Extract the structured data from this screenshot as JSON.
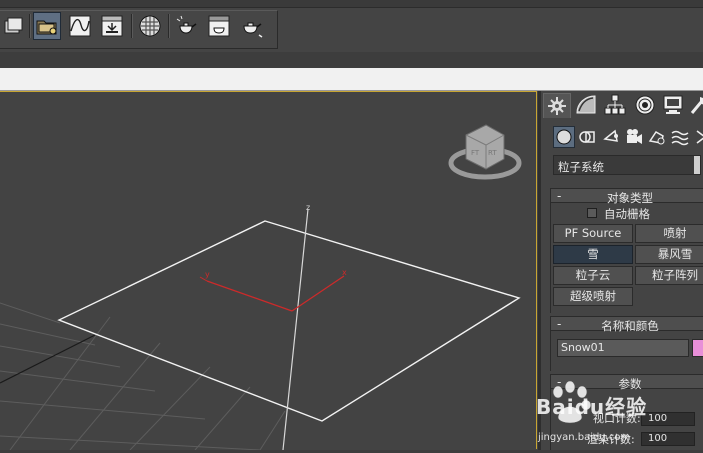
{
  "panel": {
    "category_dropdown": "粒子系统",
    "object_type": {
      "title": "对象类型",
      "autogrid_label": "自动栅格",
      "buttons": [
        "PF Source",
        "喷射",
        "雪",
        "暴风雪",
        "粒子云",
        "粒子阵列",
        "超级喷射"
      ],
      "active": "雪"
    },
    "name_color": {
      "title": "名称和颜色",
      "name": "Snow01",
      "color": "#e88fd8"
    },
    "parameters": {
      "title": "参数",
      "viewport_count_label": "视口计数:",
      "viewport_count": "100",
      "render_count_label": "渲染计数:",
      "render_count": "100"
    },
    "collapse_symbol": "-"
  },
  "viewport": {
    "axis_x": "x",
    "axis_y": "y",
    "axis_z": "z",
    "active_frame_color": "#c8a632",
    "gizmo_color": "#cc2a2a"
  },
  "watermark": {
    "brand": "Baidu经验",
    "url": "jingyan.baidu.com"
  },
  "icons": {
    "toolbar": [
      "prev-icon",
      "open-folder-icon",
      "curve-editor-icon",
      "schematic-view-icon",
      "material-editor-icon",
      "render-setup-icon",
      "rendered-frame-icon",
      "render-icon"
    ],
    "panel_tabs": [
      "create-icon",
      "modify-icon",
      "hierarchy-icon",
      "motion-icon",
      "display-icon",
      "utilities-icon"
    ],
    "sub_tabs": [
      "geometry-icon",
      "shapes-icon",
      "lights-icon",
      "cameras-icon",
      "helpers-icon",
      "spacewarps-icon",
      "systems-icon"
    ]
  }
}
